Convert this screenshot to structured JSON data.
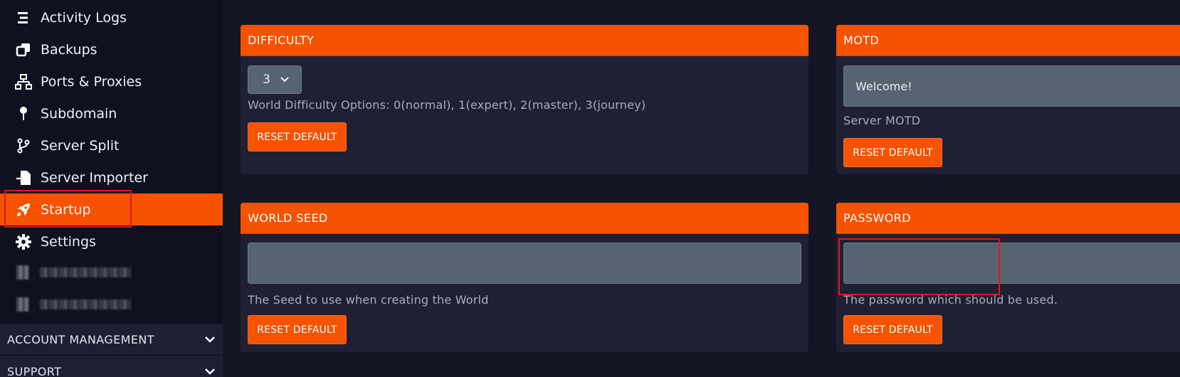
{
  "sidebar": {
    "items": [
      {
        "label": "Activity Logs",
        "icon": "list-icon"
      },
      {
        "label": "Backups",
        "icon": "copy-icon"
      },
      {
        "label": "Ports & Proxies",
        "icon": "network-icon"
      },
      {
        "label": "Subdomain",
        "icon": "pin-icon"
      },
      {
        "label": "Server Split",
        "icon": "branch-icon"
      },
      {
        "label": "Server Importer",
        "icon": "file-import-icon"
      },
      {
        "label": "Startup",
        "icon": "rocket-icon",
        "active": true
      },
      {
        "label": "Settings",
        "icon": "gear-icon"
      }
    ],
    "sections": [
      {
        "label": "ACCOUNT MANAGEMENT"
      },
      {
        "label": "SUPPORT"
      }
    ]
  },
  "cards": {
    "difficulty": {
      "title": "DIFFICULTY",
      "selected": "3",
      "description": "World Difficulty  Options: 0(normal), 1(expert), 2(master), 3(journey)",
      "reset_label": "RESET DEFAULT"
    },
    "motd": {
      "title": "MOTD",
      "value": "Welcome!",
      "description": "Server MOTD",
      "reset_label": "RESET DEFAULT"
    },
    "world_seed": {
      "title": "WORLD SEED",
      "value": "",
      "description": "The Seed to use when creating the World",
      "reset_label": "RESET DEFAULT"
    },
    "password": {
      "title": "PASSWORD",
      "value": "",
      "description": "The password which should be used.",
      "reset_label": "RESET DEFAULT"
    }
  },
  "colors": {
    "accent": "#f75200",
    "sidebar_bg": "#0f1020",
    "page_bg": "#141626",
    "card_bg": "#1f2033",
    "input_bg": "#566472",
    "highlight": "#e3161d"
  }
}
